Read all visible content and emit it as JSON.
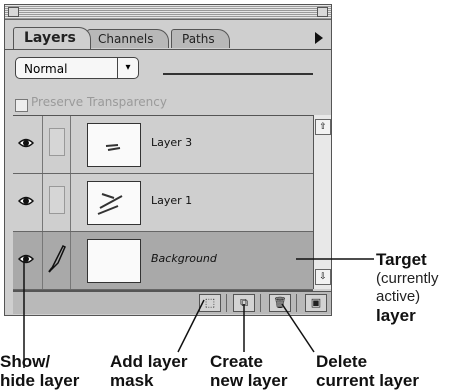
{
  "palette": {
    "tabs": [
      {
        "label": "Layers",
        "active": true
      },
      {
        "label": "Channels",
        "active": false
      },
      {
        "label": "Paths",
        "active": false
      }
    ],
    "blend_mode": "Normal",
    "preserve_transparency": "Preserve Transparency",
    "layers": [
      {
        "name": "Layer 3",
        "visible": true,
        "active": false
      },
      {
        "name": "Layer 1",
        "visible": true,
        "active": false
      },
      {
        "name": "Background",
        "visible": true,
        "active": true
      }
    ],
    "bottom_icons": [
      "add-mask-icon",
      "new-layer-icon",
      "trash-icon",
      "scroll-corner-icon"
    ]
  },
  "annotations": {
    "target_title": "Target",
    "target_detail_1": "(currently",
    "target_detail_2": "active)",
    "target_last": "layer",
    "show_hide_1": "Show/",
    "show_hide_2": "hide layer",
    "add_mask_1": "Add layer",
    "add_mask_2": "mask",
    "create_1": "Create",
    "create_2": "new layer",
    "delete_1": "Delete",
    "delete_2": "current layer"
  },
  "colors": {
    "panel": "#cfcfcf",
    "active_row": "#a9a9a9",
    "text": "#111111"
  }
}
